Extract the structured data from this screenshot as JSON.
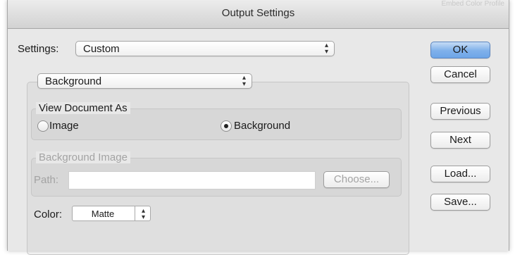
{
  "window": {
    "title": "Output Settings",
    "background_window_text": "Embed Color Profile"
  },
  "settings": {
    "label": "Settings:",
    "value": "Custom"
  },
  "section": {
    "value": "Background"
  },
  "view_document_as": {
    "legend": "View Document As",
    "options": [
      {
        "label": "Image",
        "selected": false
      },
      {
        "label": "Background",
        "selected": true
      }
    ]
  },
  "background_image": {
    "legend": "Background Image",
    "path_label": "Path:",
    "path_value": "",
    "choose_label": "Choose..."
  },
  "color": {
    "label": "Color:",
    "value": "Matte"
  },
  "buttons": {
    "ok": "OK",
    "cancel": "Cancel",
    "previous": "Previous",
    "next": "Next",
    "load": "Load...",
    "save": "Save..."
  },
  "colors": {
    "default_button": "#7fb0ea",
    "dialog_bg": "#e8e8e8"
  },
  "icons": {
    "popup_arrows": "up-down-arrows-icon"
  }
}
